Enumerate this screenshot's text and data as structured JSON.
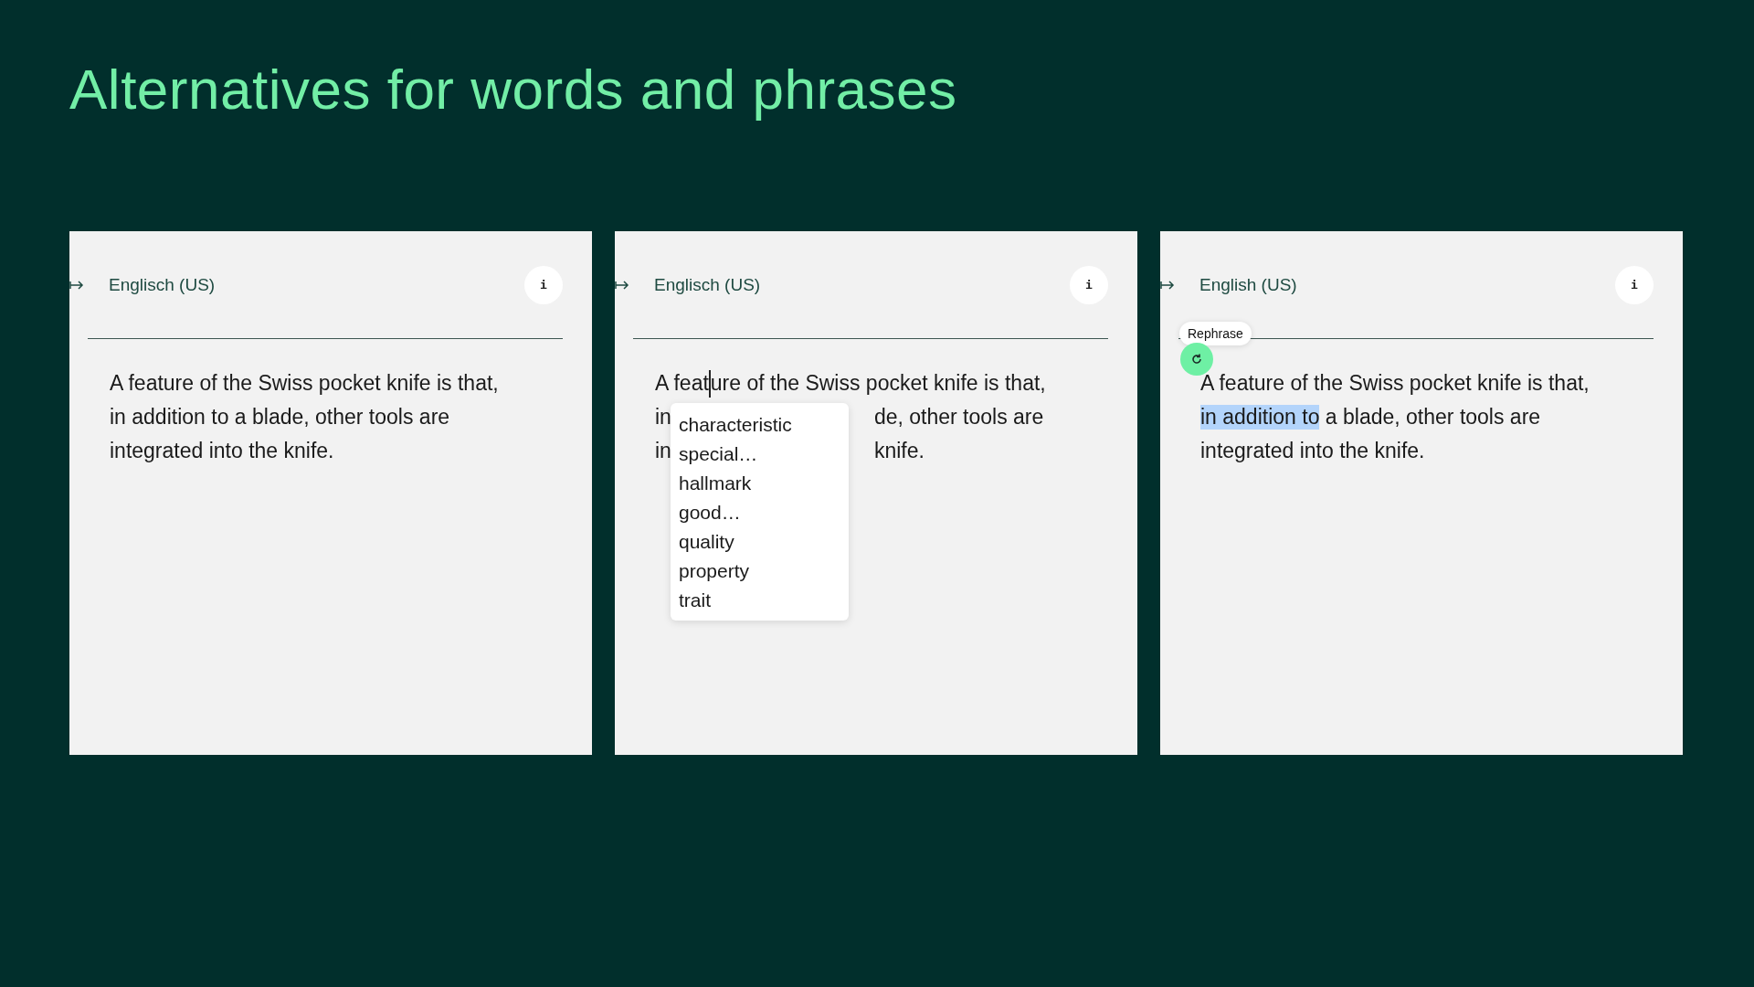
{
  "title": "Alternatives for words and phrases",
  "panels": [
    {
      "language": "Englisch (US)",
      "info": "i",
      "lines": [
        {
          "parts": [
            {
              "kind": "text",
              "text": "A feature of the Swiss pocket knife is that,",
              "highlighted": false
            }
          ]
        },
        {
          "parts": [
            {
              "kind": "text",
              "text": "in addition to a blade, other tools are",
              "highlighted": false
            }
          ]
        },
        {
          "parts": [
            {
              "kind": "text",
              "text": "integrated into the knife.",
              "highlighted": false
            }
          ]
        }
      ]
    },
    {
      "language": "Englisch (US)",
      "info": "i",
      "lines": [
        {
          "parts": [
            {
              "kind": "text",
              "text": "A feat",
              "highlighted": false
            },
            {
              "kind": "caret"
            },
            {
              "kind": "text",
              "text": "ure of the Swiss pocket knife is that,",
              "highlighted": false
            }
          ]
        },
        {
          "parts": [
            {
              "kind": "text",
              "text": "in",
              "highlighted": false
            },
            {
              "kind": "covered"
            },
            {
              "kind": "text",
              "text": "de, other tools are",
              "highlighted": false
            }
          ]
        },
        {
          "parts": [
            {
              "kind": "text",
              "text": "in",
              "highlighted": false
            },
            {
              "kind": "covered"
            },
            {
              "kind": "text",
              "text": "knife.",
              "highlighted": false
            }
          ]
        }
      ],
      "suggestions": [
        "characteristic",
        "special…",
        "hallmark",
        "good…",
        "quality",
        "property",
        "trait"
      ]
    },
    {
      "language": "English (US)",
      "info": "i",
      "lines": [
        {
          "parts": [
            {
              "kind": "text",
              "text": "A feature of the Swiss pocket knife is that,",
              "highlighted": false
            }
          ]
        },
        {
          "parts": [
            {
              "kind": "text",
              "text": "in addition to",
              "highlighted": true
            },
            {
              "kind": "text",
              "text": " a blade, other tools are",
              "highlighted": false
            }
          ]
        },
        {
          "parts": [
            {
              "kind": "text",
              "text": "integrated into the knife.",
              "highlighted": false
            }
          ]
        }
      ],
      "tooltip": "Rephrase"
    }
  ]
}
